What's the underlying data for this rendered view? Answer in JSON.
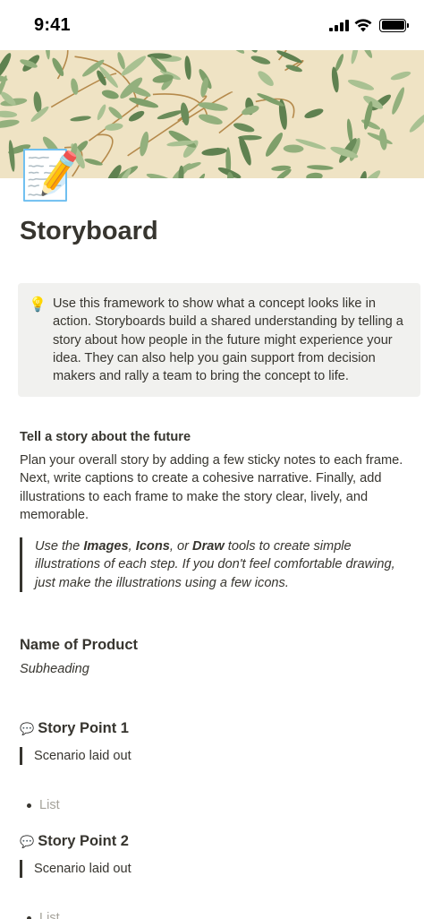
{
  "status": {
    "time": "9:41"
  },
  "page": {
    "icon": "📝",
    "title": "Storyboard"
  },
  "callout": {
    "icon": "💡",
    "text": "Use this framework to show what a concept looks like in action. Storyboards build a shared understanding by telling a story about how people in the future might experience your idea. They can also help you gain support from decision makers and rally a team to bring the concept to life."
  },
  "section_future": {
    "heading": "Tell a story about the future",
    "body": "Plan your overall story by adding a few sticky notes to each frame. Next, write captions to create a cohesive narrative. Finally, add illustrations to each frame to make the story clear, lively, and memorable."
  },
  "quote": {
    "part1": "Use the ",
    "images": "Images",
    "sep1": ", ",
    "icons": "Icons",
    "sep2": ", or ",
    "draw": "Draw",
    "part2": " tools to create simple illustrations of each step. If you don't feel comfortable drawing, just make the illustrations using a few icons."
  },
  "product": {
    "name": "Name of Product",
    "subheading": "Subheading"
  },
  "story_points": [
    {
      "icon": "💬",
      "title": "Story Point 1",
      "scenario": "Scenario laid out",
      "list_placeholder": "List"
    },
    {
      "icon": "💬",
      "title": "Story Point 2",
      "scenario": "Scenario laid out",
      "list_placeholder": "List"
    }
  ],
  "colors": {
    "text": "#37352f",
    "callout_bg": "#f1f1ef",
    "placeholder": "#a6a39b",
    "cover_bg": "#efe3c4",
    "cover_leaf": "#7e9f6a"
  }
}
